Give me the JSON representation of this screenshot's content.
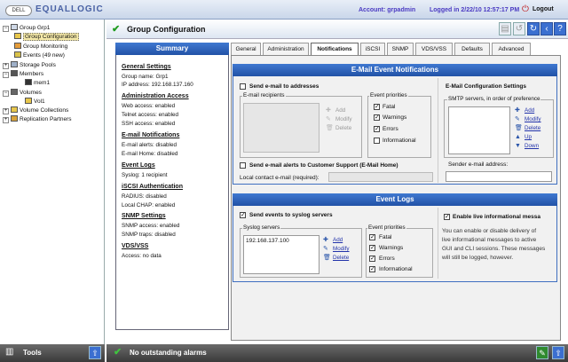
{
  "app": {
    "logo": "DELL",
    "brand": "EQUALLOGIC"
  },
  "topbar": {
    "account": "Account: grpadmin",
    "logged_in": "Logged in 2/22/10 12:57:17 PM",
    "logout": "Logout"
  },
  "tree": {
    "items": [
      {
        "label": "Group Grp1"
      },
      {
        "label": "Group Configuration"
      },
      {
        "label": "Group Monitoring"
      },
      {
        "label": "Events (49 new)"
      },
      {
        "label": "Storage Pools"
      },
      {
        "label": "Members"
      },
      {
        "label": "mem1"
      },
      {
        "label": "Volumes"
      },
      {
        "label": "Vol1"
      },
      {
        "label": "Volume Collections"
      },
      {
        "label": "Replication Partners"
      }
    ]
  },
  "header": {
    "title": "Group Configuration"
  },
  "summary": {
    "title": "Summary",
    "general": {
      "heading": "General Settings",
      "lines": [
        "Group name: Grp1",
        "IP address:  192.168.137.160"
      ]
    },
    "admin": {
      "heading": "Administration Access",
      "lines": [
        "Web access: enabled",
        "Telnet access: enabled",
        "SSH access: enabled"
      ]
    },
    "email": {
      "heading": "E-mail Notifications",
      "lines": [
        "E-mail alerts: disabled",
        "E-mail Home: disabled"
      ]
    },
    "events": {
      "heading": "Event Logs",
      "lines": [
        "Syslog: 1 recipient"
      ]
    },
    "iscsi": {
      "heading": "iSCSI Authentication",
      "lines": [
        "RADIUS: disabled",
        "Local CHAP: enabled"
      ]
    },
    "snmp": {
      "heading": "SNMP Settings",
      "lines": [
        "SNMP access: enabled",
        "SNMP traps: disabled"
      ]
    },
    "vds": {
      "heading": "VDS/VSS",
      "lines": [
        "Access: no data"
      ]
    }
  },
  "tabs": [
    "General",
    "Administration",
    "Notifications",
    "iSCSI",
    "SNMP",
    "VDS/VSS",
    "Defaults",
    "Advanced"
  ],
  "email_panel": {
    "title": "E-Mail Event Notifications",
    "send_email": "Send e-mail to addresses",
    "recipients_legend": "E-mail recipients",
    "add": "Add",
    "modify": "Modify",
    "delete": "Delete",
    "priorities_legend": "Event priorities",
    "priorities": [
      {
        "label": "Fatal",
        "checked": true
      },
      {
        "label": "Warnings",
        "checked": true
      },
      {
        "label": "Errors",
        "checked": true
      },
      {
        "label": "Informational",
        "checked": false
      }
    ],
    "support_alerts": "Send e-mail alerts to Customer Support (E-Mail Home)",
    "local_contact": "Local contact e-mail (required):",
    "config_title": "E-Mail Configuration Settings",
    "smtp_legend": "SMTP servers, in order of preference",
    "smtp_add": "Add",
    "smtp_modify": "Modify",
    "smtp_delete": "Delete",
    "up": "Up",
    "down": "Down",
    "sender": "Sender e-mail address:"
  },
  "event_panel": {
    "title": "Event Logs",
    "send_syslog": "Send events to syslog servers",
    "syslog_legend": "Syslog servers",
    "servers": [
      "192.168.137.100"
    ],
    "add": "Add",
    "modify": "Modify",
    "delete": "Delete",
    "priorities_legend": "Event priorities",
    "priorities": [
      {
        "label": "Fatal"
      },
      {
        "label": "Warnings"
      },
      {
        "label": "Errors"
      },
      {
        "label": "Informational"
      }
    ],
    "live_info": "Enable live informational messa",
    "live_desc": [
      "You can enable or disable delivery of",
      "live informational messages to active",
      "GUI and CLI sessions. These messages",
      "will still be logged, however."
    ]
  },
  "bottom": {
    "tools": "Tools",
    "alarms": "No outstanding alarms"
  }
}
